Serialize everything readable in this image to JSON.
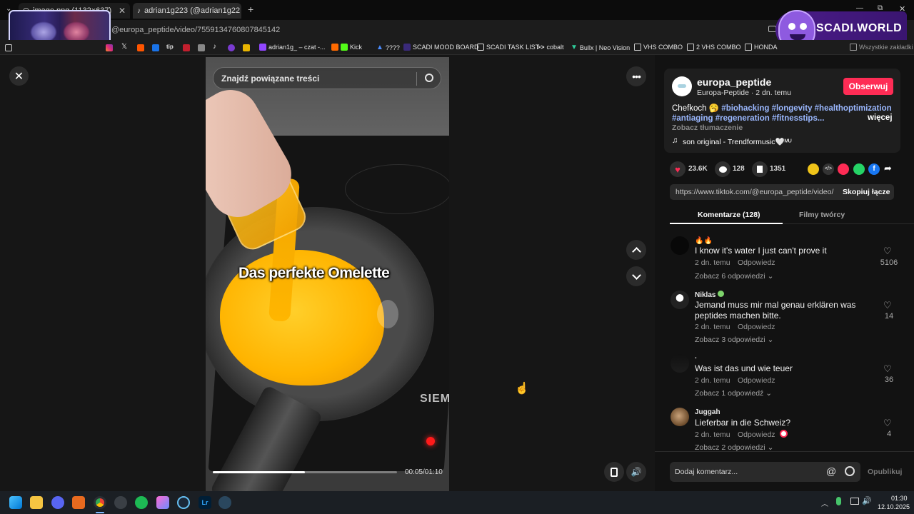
{
  "browser": {
    "tabs": [
      {
        "title": "image.png (1132×637)"
      },
      {
        "title": "adrian1g223 (@adrian1g22"
      }
    ],
    "url": "@europa_peptide/video/7559134760807845142",
    "bookmarks": [
      {
        "label": "adrian1g_ – czat -..."
      },
      {
        "label": "Kick"
      },
      {
        "label": "????"
      },
      {
        "label": "SCADI MOOD BOARD"
      },
      {
        "label": "SCADI TASK LIST"
      },
      {
        "label": "cobalt"
      },
      {
        "label": "Bullx | Neo Vision"
      },
      {
        "label": "VHS COMBO"
      },
      {
        "label": "2 VHS COMBO"
      },
      {
        "label": "HONDA"
      },
      {
        "label": "Wszystkie zakładki"
      }
    ],
    "brand_overlay": "SCADI.WORLD"
  },
  "search": {
    "placeholder": "Znajdź powiązane treści"
  },
  "video": {
    "caption_overlay": "Das perfekte Omelette",
    "progress": 0.5,
    "time": "00:05/01:10",
    "brand_on_stove": "SIEMENS"
  },
  "author": {
    "handle": "europa_peptide",
    "subline": "Europa-Peptide · 2 dn. temu",
    "follow_label": "Obserwuj"
  },
  "description": {
    "lead": "Chefkoch 🥱 ",
    "tags_line1": "#biohacking #longevity #healthoptimization",
    "tags_line2": "#antiaging #regeneration #fitnesstips...",
    "more_label": "więcej",
    "translate_label": "Zobacz tłumaczenie",
    "music": "son original - Trendformusic🤍ᴹᵁ"
  },
  "stats": {
    "likes": "23.6K",
    "comments": "128",
    "saves": "1351"
  },
  "share_link": {
    "url": "https://www.tiktok.com/@europa_peptide/video/...",
    "copy_label": "Skopiuj łącze"
  },
  "tabs": [
    {
      "label": "Komentarze (128)"
    },
    {
      "label": "Filmy twórcy"
    }
  ],
  "comments": [
    {
      "name": "🔥🔥",
      "text": "I know it's water I just can't prove it",
      "time": "2 dn. temu",
      "reply": "Odpowiedz",
      "replies": "Zobacz 6 odpowiedzi",
      "likes": "5106"
    },
    {
      "name": "Niklas",
      "text": "Jemand muss mir mal genau erklären was peptides machen bitte.",
      "time": "2 dn. temu",
      "reply": "Odpowiedz",
      "replies": "Zobacz 3 odpowiedzi",
      "likes": "14"
    },
    {
      "name": ".",
      "text": "Was ist das und wie teuer",
      "time": "2 dn. temu",
      "reply": "Odpowiedz",
      "replies": "Zobacz 1 odpowiedź",
      "likes": "36"
    },
    {
      "name": "Juggah",
      "text": "Lieferbar in die Schweiz?",
      "time": "2 dn. temu",
      "reply": "Odpowiedz",
      "replies": "Zobacz 2 odpowiedzi",
      "likes": "4"
    }
  ],
  "comment_input": {
    "placeholder": "Dodaj komentarz...",
    "publish_label": "Opublikuj"
  },
  "taskbar": {
    "time": "01:30",
    "date": "12.10.2025"
  },
  "colors": {
    "accent": "#fe2c55",
    "hashtag": "#9bb8ff",
    "bg": "#121212"
  }
}
